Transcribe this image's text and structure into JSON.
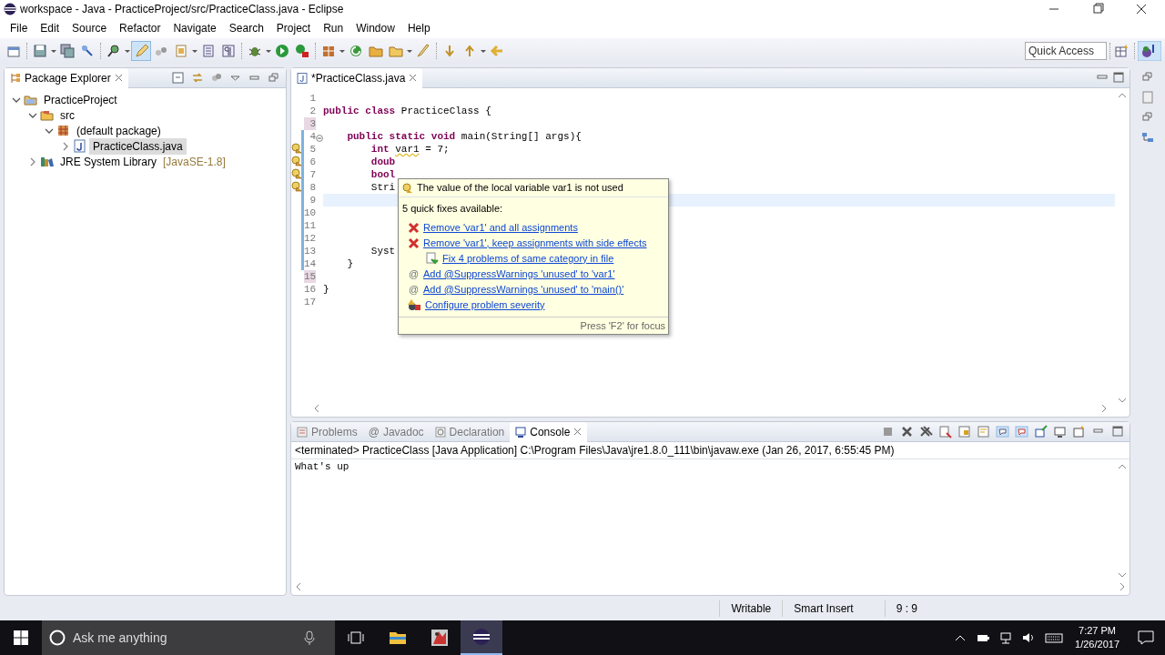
{
  "window": {
    "title": "workspace - Java - PracticeProject/src/PracticeClass.java - Eclipse"
  },
  "menu": [
    "File",
    "Edit",
    "Source",
    "Refactor",
    "Navigate",
    "Search",
    "Project",
    "Run",
    "Window",
    "Help"
  ],
  "toolbar": [
    {
      "on": false
    },
    {
      "on": false
    },
    {
      "on": false
    },
    {
      "on": false
    },
    {
      "on": false
    },
    {
      "on": true
    },
    {
      "on": false
    },
    {
      "on": false
    },
    {
      "on": false
    },
    {
      "on": false
    },
    {
      "on": false
    },
    {
      "on": false
    },
    {
      "on": false
    },
    {
      "on": false
    },
    {
      "on": false
    },
    {
      "on": false
    },
    {
      "on": false
    },
    {
      "on": false
    },
    {
      "on": false
    },
    {
      "on": false
    },
    {
      "on": false
    }
  ],
  "quick_access": {
    "placeholder": "Quick Access"
  },
  "package_explorer": {
    "title": "Package Explorer",
    "tree": [
      {
        "label": "PracticeProject",
        "kind": "project",
        "expanded": true,
        "selected": false,
        "children": [
          {
            "label": "src",
            "kind": "folder",
            "expanded": true,
            "selected": false,
            "children": [
              {
                "label": "(default package)",
                "kind": "package",
                "expanded": true,
                "selected": false,
                "children": [
                  {
                    "label": "PracticeClass.java",
                    "kind": "file",
                    "expanded": false,
                    "selected": true
                  }
                ]
              }
            ]
          },
          {
            "label": "JRE System Library",
            "suffix": "[JavaSE-1.8]",
            "kind": "library",
            "expanded": false,
            "selected": false
          }
        ]
      }
    ]
  },
  "editor": {
    "tab": {
      "label": "*PracticeClass.java",
      "selected": true
    },
    "lines": [
      {
        "number": "1",
        "warning": false,
        "changed": false,
        "marked": false,
        "current": false,
        "foldable": false
      },
      {
        "number": "2",
        "warning": false,
        "changed": false,
        "marked": false,
        "current": false,
        "foldable": false,
        "segments": [
          {
            "text": "public class",
            "kind": "keyword"
          },
          {
            "text": " PracticeClass {",
            "kind": "plain"
          }
        ]
      },
      {
        "number": "3",
        "warning": false,
        "changed": false,
        "marked": true,
        "current": false,
        "foldable": false
      },
      {
        "number": "4",
        "warning": false,
        "changed": true,
        "marked": false,
        "current": false,
        "foldable": true,
        "segments": [
          {
            "text": "    public static void",
            "kind": "keyword"
          },
          {
            "text": " main(String[] args){",
            "kind": "plain"
          }
        ]
      },
      {
        "number": "5",
        "warning": true,
        "changed": true,
        "marked": false,
        "current": false,
        "foldable": false,
        "segments": [
          {
            "text": "        int ",
            "kind": "keyword"
          },
          {
            "text": "var1",
            "kind": "warning"
          },
          {
            "text": " = 7;",
            "kind": "plain"
          }
        ]
      },
      {
        "number": "6",
        "warning": true,
        "changed": true,
        "marked": false,
        "current": false,
        "foldable": false,
        "segments": [
          {
            "text": "        doub",
            "kind": "keyword"
          }
        ]
      },
      {
        "number": "7",
        "warning": true,
        "changed": true,
        "marked": false,
        "current": false,
        "foldable": false,
        "segments": [
          {
            "text": "        bool",
            "kind": "keyword"
          }
        ]
      },
      {
        "number": "8",
        "warning": true,
        "changed": true,
        "marked": false,
        "current": false,
        "foldable": false,
        "segments": [
          {
            "text": "        Stri",
            "kind": "plain"
          }
        ]
      },
      {
        "number": "9",
        "warning": false,
        "changed": true,
        "marked": false,
        "current": true,
        "foldable": false
      },
      {
        "number": "10",
        "warning": false,
        "changed": true,
        "marked": false,
        "current": false,
        "foldable": false
      },
      {
        "number": "11",
        "warning": false,
        "changed": true,
        "marked": false,
        "current": false,
        "foldable": false
      },
      {
        "number": "12",
        "warning": false,
        "changed": true,
        "marked": false,
        "current": false,
        "foldable": false
      },
      {
        "number": "13",
        "warning": false,
        "changed": true,
        "marked": false,
        "current": false,
        "foldable": false,
        "segments": [
          {
            "text": "        Syst",
            "kind": "plain"
          }
        ]
      },
      {
        "number": "14",
        "warning": false,
        "changed": true,
        "marked": false,
        "current": false,
        "foldable": false,
        "segments": [
          {
            "text": "    }",
            "kind": "plain"
          }
        ]
      },
      {
        "number": "15",
        "warning": false,
        "changed": false,
        "marked": true,
        "current": false,
        "foldable": false
      },
      {
        "number": "16",
        "warning": false,
        "changed": false,
        "marked": false,
        "current": false,
        "foldable": false,
        "segments": [
          {
            "text": "}",
            "kind": "plain"
          }
        ]
      },
      {
        "number": "17",
        "warning": false,
        "changed": false,
        "marked": false,
        "current": false,
        "foldable": false
      }
    ],
    "hover": {
      "message": "The value of the local variable var1 is not used",
      "subtitle": "5 quick fixes available:",
      "fixes": [
        {
          "label": "Remove 'var1' and all assignments",
          "kind": "remove"
        },
        {
          "label": "Remove 'var1', keep assignments with side effects",
          "kind": "remove"
        },
        {
          "label": "Fix 4 problems of same category in file",
          "kind": "multi"
        },
        {
          "label": "Add @SuppressWarnings 'unused' to 'var1'",
          "kind": "annotation",
          "glyph": "@"
        },
        {
          "label": "Add @SuppressWarnings 'unused' to 'main()'",
          "kind": "annotation",
          "glyph": "@"
        },
        {
          "label": "Configure problem severity",
          "kind": "configure"
        }
      ],
      "footer": "Press 'F2' for focus"
    }
  },
  "bottom_panel": {
    "tabs": [
      {
        "label": "Problems",
        "selected": false
      },
      {
        "label": "Javadoc",
        "selected": false,
        "glyph": "@"
      },
      {
        "label": "Declaration",
        "selected": false
      },
      {
        "label": "Console",
        "selected": true
      }
    ],
    "console_header": "<terminated> PracticeClass [Java Application] C:\\Program Files\\Java\\jre1.8.0_111\\bin\\javaw.exe (Jan 26, 2017, 6:55:45 PM)",
    "output": "What's up"
  },
  "status_bar": [
    "Writable",
    "Smart Insert",
    "9 : 9"
  ],
  "taskbar": {
    "search": {
      "placeholder": "Ask me anything"
    },
    "apps": [
      {
        "selected": false
      },
      {
        "selected": false
      },
      {
        "selected": true
      }
    ],
    "time": "7:27 PM",
    "date": "1/26/2017"
  }
}
